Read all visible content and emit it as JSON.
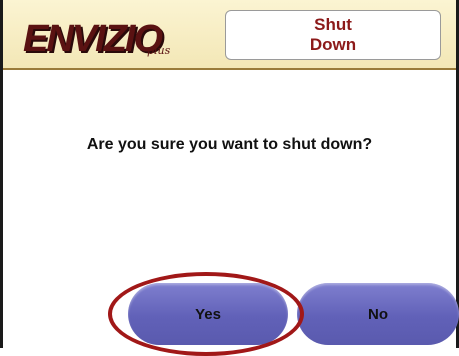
{
  "header": {
    "logo_main": "ENVIZIO",
    "logo_sub": "plus",
    "title_line1": "Shut",
    "title_line2": "Down"
  },
  "dialog": {
    "prompt": "Are you sure you want to shut down?",
    "yes_label": "Yes",
    "no_label": "No"
  },
  "colors": {
    "header_bg": "#f3e7b6",
    "title_text": "#8c1a1a",
    "button": "#6666bb",
    "annotation": "#a11818"
  }
}
